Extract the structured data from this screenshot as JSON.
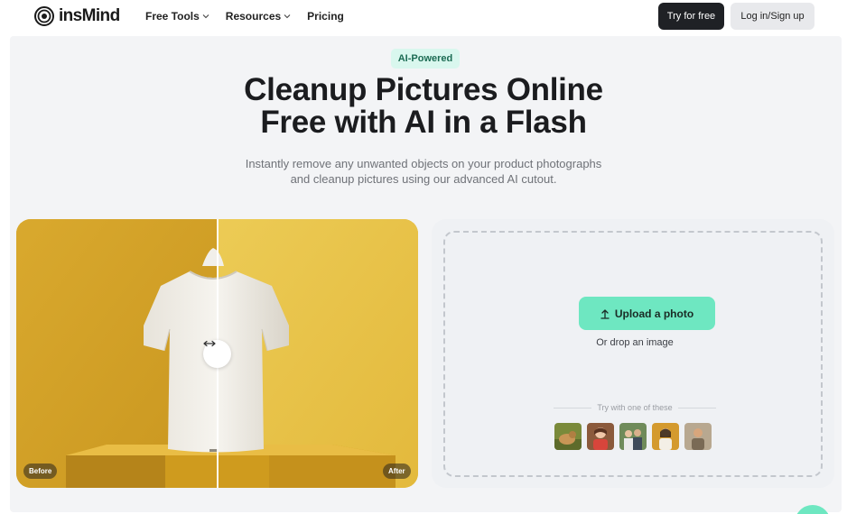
{
  "nav": {
    "brand": "insMind",
    "items": [
      {
        "label": "Free Tools",
        "dropdown": true
      },
      {
        "label": "Resources",
        "dropdown": true
      },
      {
        "label": "Pricing",
        "dropdown": false
      }
    ],
    "try_button": "Try for free",
    "login_button": "Log in/Sign up"
  },
  "hero": {
    "badge": "AI-Powered",
    "title_line1": "Cleanup Pictures Online",
    "title_line2": "Free with AI in a Flash",
    "subtitle_line1": "Instantly remove any unwanted objects on your product photographs",
    "subtitle_line2": "and cleanup pictures using our advanced AI cutout."
  },
  "compare": {
    "before_label": "Before",
    "after_label": "After",
    "handle_icon": "double-arrow-icon",
    "background_color": "#e2b83f"
  },
  "upload": {
    "button_label": "Upload a photo",
    "button_icon": "upload-arrow-icon",
    "drop_text": "Or drop an image",
    "try_text": "Try with one of these",
    "samples": [
      "sample-dog",
      "sample-girl",
      "sample-people",
      "sample-woman",
      "sample-man"
    ]
  },
  "colors": {
    "accent": "#6ee7c1",
    "badge_bg": "#d9f7ee",
    "dark_button": "#1f2125",
    "hero_bg": "#f3f4f6"
  }
}
